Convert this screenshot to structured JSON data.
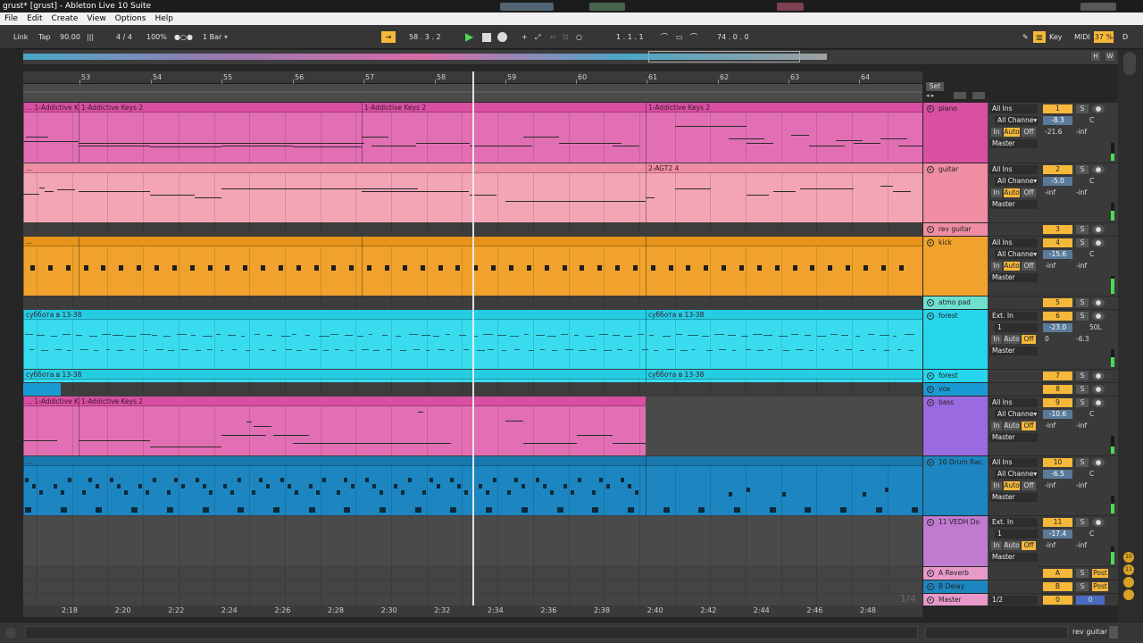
{
  "window": {
    "title": "grust*  [grust] - Ableton Live 10 Suite"
  },
  "menu": [
    "File",
    "Edit",
    "Create",
    "View",
    "Options",
    "Help"
  ],
  "control_bar": {
    "link": "Link",
    "tap": "Tap",
    "tempo": "90.00",
    "metronome_icon": "bars-icon",
    "signature": "4 / 4",
    "zoom": "100%",
    "loop_dots": "●○●",
    "quantize": "1 Bar",
    "arrangement_position": "58 .   3 .   2",
    "loop_start": "1 .   1 .   1",
    "loop_length": "74 .   0 .   0",
    "key": "Key",
    "midi": "MIDI",
    "cpu": "37 %",
    "disk": "D"
  },
  "ruler": {
    "bars": [
      "53",
      "54",
      "55",
      "56",
      "57",
      "58",
      "59",
      "60",
      "61",
      "62",
      "63",
      "64"
    ],
    "set_label": "Set"
  },
  "timeline": [
    "2:18",
    "2:20",
    "2:22",
    "2:24",
    "2:26",
    "2:28",
    "2:30",
    "2:32",
    "2:34",
    "2:36",
    "2:38",
    "2:40",
    "2:42",
    "2:44",
    "2:46",
    "2:48"
  ],
  "overview_labels": [
    "H",
    "W"
  ],
  "clips": {
    "piano": [
      "... 1-Addictive K",
      "1-Addictive Keys 2",
      "1-Addictive Keys 2",
      "1-Addictive Keys 2"
    ],
    "guitar": [
      "...",
      "2-AGT2 4"
    ],
    "kick": [
      "..."
    ],
    "forest": [
      "суббота в 13-38",
      "суббота в 13-38"
    ],
    "forest2": [
      "суббота в 13-38",
      "суббота в 13-38"
    ],
    "bass": [
      "... 1-Addictive K",
      "1-Addictive Keys 2"
    ],
    "drum": [
      "..."
    ]
  },
  "tracks": [
    {
      "name": "piano",
      "color": "#d94fa2",
      "num": "1",
      "input": "All Ins",
      "channel": "All Channe▾",
      "volume": "-8.3",
      "pan": "C",
      "peak": "-21.6",
      "peak2": "-inf",
      "output": "Master",
      "monitor_active": "Auto"
    },
    {
      "name": "guitar",
      "color": "#ee8da3",
      "num": "2",
      "input": "All Ins",
      "channel": "All Channe▾",
      "volume": "-5.0",
      "pan": "C",
      "peak": "-inf",
      "peak2": "-inf",
      "output": "Master",
      "monitor_active": "Auto"
    },
    {
      "name": "rev guitar",
      "color": "#ee8da3",
      "num": "3"
    },
    {
      "name": "kick",
      "color": "#f0a22c",
      "num": "4",
      "input": "All Ins",
      "channel": "All Channe▾",
      "volume": "-15.6",
      "pan": "C",
      "peak": "-inf",
      "peak2": "-inf",
      "output": "Master",
      "monitor_active": "Auto"
    },
    {
      "name": "atmo pad",
      "color": "#6fe0d0",
      "num": "5"
    },
    {
      "name": "forest",
      "color": "#27d6ec",
      "num": "6",
      "input": "Ext. In",
      "channel": "1",
      "volume": "-23.0",
      "pan": "50L",
      "peak": "0",
      "peak2": "-6.3",
      "output": "Master",
      "monitor_active": "Off"
    },
    {
      "name": "forest",
      "color": "#27d6ec",
      "num": "7"
    },
    {
      "name": "vox",
      "color": "#1a9ad4",
      "num": "8"
    },
    {
      "name": "bass",
      "color": "#9a6be0",
      "num": "9",
      "input": "All Ins",
      "channel": "All Channe▾",
      "volume": "-10.6",
      "pan": "C",
      "peak": "-inf",
      "peak2": "-inf",
      "output": "Master",
      "monitor_active": "Off"
    },
    {
      "name": "10 Drum Rac",
      "color": "#1d86c1",
      "num": "10",
      "input": "All Ins",
      "channel": "All Channe▾",
      "volume": "-6.5",
      "pan": "C",
      "peak": "-inf",
      "peak2": "-inf",
      "output": "Master",
      "monitor_active": "Auto"
    },
    {
      "name": "11 VEDH Do",
      "color": "#c07bd0",
      "num": "11",
      "input": "Ext. In",
      "channel": "1",
      "volume": "-17.4",
      "pan": "C",
      "peak": "-inf",
      "peak2": "-inf",
      "output": "Master",
      "monitor_active": "Off"
    },
    {
      "name": "A Reverb",
      "color": "#e79ac9",
      "num": "A"
    },
    {
      "name": "B Delay",
      "color": "#1d86c1",
      "num": "B"
    },
    {
      "name": "Master",
      "color": "#e79ac9",
      "num": "0",
      "input": "1/2"
    }
  ],
  "mixer_labels": {
    "in": "In",
    "auto": "Auto",
    "off": "Off",
    "solo": "S",
    "post": "Post"
  },
  "sidebar_numbers": [
    "10",
    "11"
  ],
  "page_indicator": "1/4",
  "status": {
    "selected_track": "rev guitar"
  }
}
